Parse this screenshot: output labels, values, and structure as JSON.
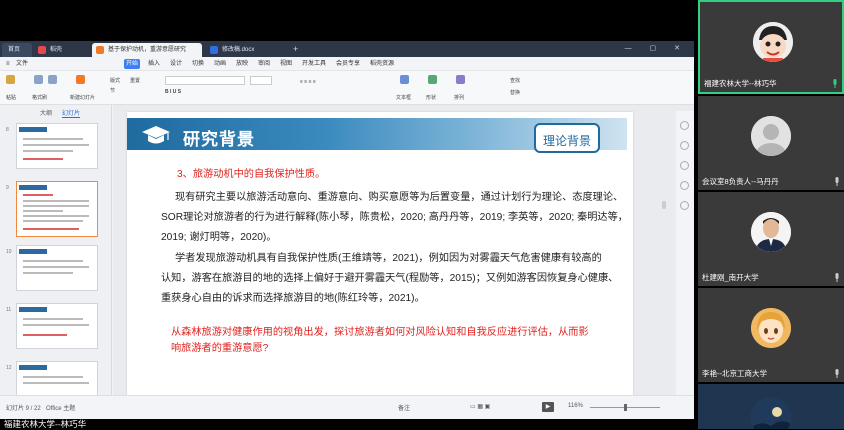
{
  "tabs": {
    "home": "首页",
    "stroke": "稻壳",
    "presentation": "基于保护动机，重游意愿研究",
    "document": "修改稿.docx",
    "add": "+"
  },
  "menu": [
    "文件",
    "开始",
    "插入",
    "设计",
    "切换",
    "动画",
    "放映",
    "审阅",
    "视图",
    "开发工具",
    "会员专享",
    "稻壳资源"
  ],
  "menu_active_index": 1,
  "ribbon": {
    "paste": "粘贴",
    "format_painter": "格式刷",
    "new_slide": "新建幻灯片",
    "layout": "版式",
    "section": "节",
    "reset": "重置",
    "text_box": "文本框",
    "shape": "形状",
    "arrange": "排列",
    "find": "查找",
    "replace": "替换"
  },
  "side_tabs": [
    "大纲",
    "幻灯片"
  ],
  "thumbnail_numbers": [
    "8",
    "9",
    "10",
    "11",
    "12"
  ],
  "slide": {
    "header_title": "研究背景",
    "badge": "理论背景",
    "lines": [
      {
        "text": "3、旅游动机中的自我保护性质。",
        "style": "head"
      },
      {
        "text": "现有研究主要以旅游活动意向、重游意向、购买意愿等为后置变量，通过计划行为理论、态度理论、",
        "style": "normal"
      },
      {
        "text": "SOR理论对旅游者的行为进行解释(陈小琴，陈贵松，2020; 高丹丹等，2019; 李英等，2020; 秦明达等，",
        "style": "normal"
      },
      {
        "text": "2019; 谢灯明等，2020)。",
        "style": "normal"
      },
      {
        "text": "学者发现旅游动机具有自我保护性质(王维靖等，2021)，例如因为对雾霾天气危害健康有较高的",
        "style": "normal"
      },
      {
        "text": "认知，游客在旅游目的地的选择上偏好于避开雾霾天气(程励等，2015)；又例如游客因恢复身心健康、",
        "style": "normal"
      },
      {
        "text": "重获身心自由的诉求而选择旅游目的地(陈红玲等，2021)。",
        "style": "normal"
      },
      {
        "text": "从森林旅游对健康作用的视角出发，探讨旅游者如何对风险认知和自我反应进行评估，从而影",
        "style": "red"
      },
      {
        "text": "响旅游者的重游意愿?",
        "style": "red"
      }
    ]
  },
  "status": {
    "slide_count": "幻灯片 9 / 22",
    "theme": "Office 主题",
    "notes": "备注",
    "zoom": "116%"
  },
  "bottom_name": "福建农林大学--林巧华",
  "participants": [
    {
      "name": "福建农林大学--林巧华",
      "active": true,
      "avatar": "cartoon"
    },
    {
      "name": "会议室8负责人--马丹丹",
      "active": false,
      "avatar": "default"
    },
    {
      "name": "杜建刚_南开大学",
      "active": false,
      "avatar": "photo"
    },
    {
      "name": "李艳--北京工商大学",
      "active": false,
      "avatar": "anime"
    },
    {
      "name": "",
      "active": false,
      "avatar": "sky"
    }
  ]
}
